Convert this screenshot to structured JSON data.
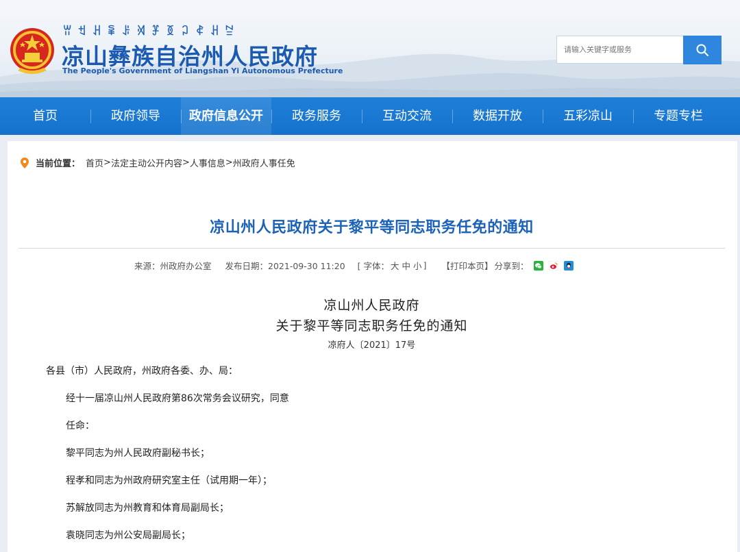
{
  "header": {
    "yi_script": "ꀕꉬꃅꈜꌠꄉꐞꅉꃀꈉꃅꊂ",
    "title": "凉山彝族自治州人民政府",
    "subtitle": "The People's Government of Liangshan Yi Autonomous Prefecture",
    "search_placeholder": "请输入关键字或服务"
  },
  "nav": {
    "items": [
      "首页",
      "政府领导",
      "政府信息公开",
      "政务服务",
      "互动交流",
      "数据开放",
      "五彩凉山",
      "专题专栏"
    ],
    "active_index": 2
  },
  "breadcrumb": {
    "label": "当前位置：",
    "items": [
      "首页",
      "法定主动公开内容",
      "人事信息",
      "州政府人事任免"
    ],
    "separator": ">"
  },
  "article": {
    "title": "凉山州人民政府关于黎平等同志职务任免的通知",
    "meta": {
      "source": "来源：州政府办公室",
      "date": "发布日期：2021-09-30 11:20",
      "font_prefix": "[ 字体：",
      "font_large": "大",
      "font_medium": "中",
      "font_small": "小",
      "font_suffix": "]",
      "print": "【打印本页】",
      "share": "分享到："
    },
    "doc_heading_1": "凉山州人民政府",
    "doc_heading_2": "关于黎平等同志职务任免的通知",
    "doc_number": "凉府人〔2021〕17号",
    "addressee": "各县（市）人民政府，州政府各委、办、局：",
    "paragraphs": [
      "经十一届凉山州人民政府第86次常务会议研究，同意",
      "任命：",
      "黎平同志为州人民政府副秘书长；",
      "程孝和同志为州政府研究室主任（试用期一年）；",
      "苏解放同志为州教育和体育局副局长；",
      "袁晓同志为州公安局副局长；"
    ]
  },
  "colors": {
    "brand_blue": "#1a5ab0",
    "nav_blue": "#1e7fd8",
    "title_blue": "#1b62b8"
  },
  "icons": {
    "emblem": "national-emblem-icon",
    "search": "search-icon",
    "location": "location-pin-icon",
    "wechat": "wechat-icon",
    "weibo": "weibo-icon",
    "qq": "qq-icon"
  }
}
